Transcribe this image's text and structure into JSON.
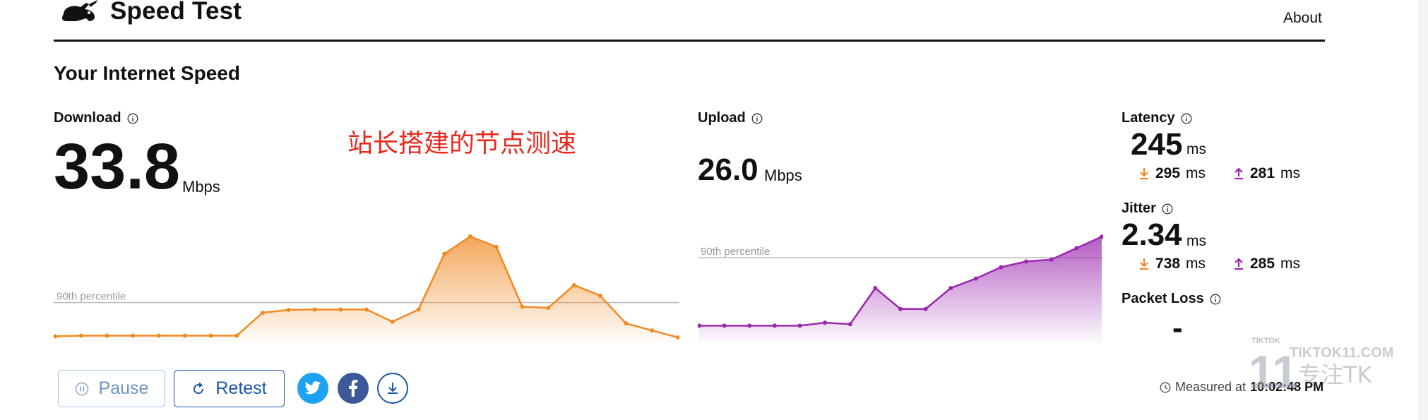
{
  "header": {
    "app_title": "Speed Test",
    "about_label": "About",
    "logo_icon": "rabbit-icon"
  },
  "section_title": "Your Internet Speed",
  "overlay_text": "站长搭建的节点测速",
  "download": {
    "label": "Download",
    "value": "33.8",
    "unit": "Mbps",
    "percentile_label": "90th percentile",
    "color": "#f08a24"
  },
  "upload": {
    "label": "Upload",
    "value": "26.0",
    "unit": "Mbps",
    "percentile_label": "90th percentile",
    "color": "#9b27af"
  },
  "latency": {
    "label": "Latency",
    "value": "245",
    "unit": "ms",
    "down_value": "295",
    "down_unit": "ms",
    "up_value": "281",
    "up_unit": "ms"
  },
  "jitter": {
    "label": "Jitter",
    "value": "2.34",
    "unit": "ms",
    "down_value": "738",
    "down_unit": "ms",
    "up_value": "285",
    "up_unit": "ms"
  },
  "packet_loss": {
    "label": "Packet Loss",
    "value": "-"
  },
  "buttons": {
    "pause_label": "Pause",
    "retest_label": "Retest"
  },
  "measured": {
    "prefix": "Measured at",
    "time": "10:02:48 PM"
  },
  "watermark": {
    "top": "TIKTOK",
    "domain": "TIKTOK11.COM",
    "number": "11",
    "tagline": "专注TK"
  },
  "colors": {
    "accent_blue": "#1a56a8",
    "twitter": "#1da1f2",
    "facebook": "#3b5998"
  },
  "chart_data": [
    {
      "type": "area",
      "name": "download",
      "x": [
        0,
        1,
        2,
        3,
        4,
        5,
        6,
        7,
        8,
        9,
        10,
        11,
        12,
        13,
        14,
        15,
        16,
        17,
        18,
        19,
        20,
        21,
        22,
        23,
        24
      ],
      "y": [
        0.3,
        0.5,
        0.5,
        0.5,
        0.5,
        0.5,
        0.5,
        0.5,
        7.1,
        7.9,
        8.0,
        8.0,
        8.0,
        4.5,
        8.0,
        24.0,
        29.0,
        26.0,
        8.8,
        8.5,
        15.0,
        12.0,
        4.0,
        2.0,
        0.0
      ],
      "percentile_90": 10.0,
      "ylim": [
        0,
        30
      ]
    },
    {
      "type": "area",
      "name": "upload",
      "x": [
        0,
        1,
        2,
        3,
        4,
        5,
        6,
        7,
        8,
        9,
        10,
        11,
        12,
        13,
        14,
        15,
        16
      ],
      "y": [
        1.6,
        1.6,
        1.6,
        1.6,
        1.6,
        2.4,
        2.0,
        11.5,
        6.0,
        6.0,
        11.5,
        14.0,
        17.0,
        18.5,
        19.0,
        22.0,
        25.0
      ],
      "percentile_90": 19.5,
      "ylim": [
        0,
        26
      ]
    }
  ]
}
